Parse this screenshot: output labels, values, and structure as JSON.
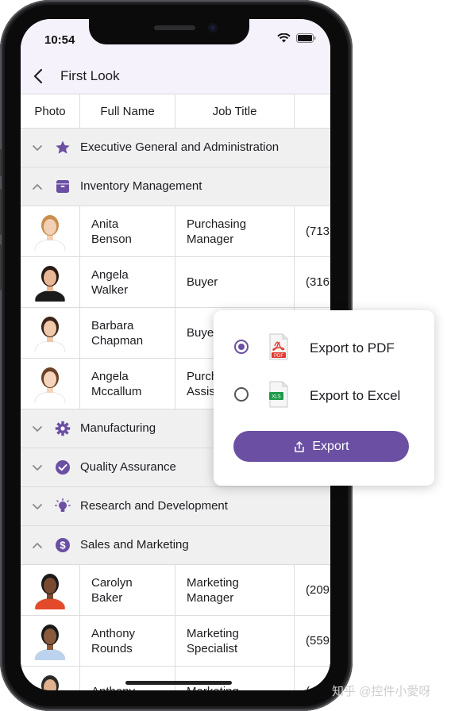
{
  "status": {
    "time": "10:54"
  },
  "appbar": {
    "title": "First Look"
  },
  "grid": {
    "columns": [
      "Photo",
      "Full Name",
      "Job Title"
    ],
    "groups": [
      {
        "label": "Executive General and Administration",
        "icon": "star-icon",
        "expanded": false
      },
      {
        "label": "Inventory Management",
        "icon": "box-icon",
        "expanded": true,
        "rows": [
          {
            "name": "Anita\nBenson",
            "job": "Purchasing\nManager",
            "phone": "(713"
          },
          {
            "name": "Angela\nWalker",
            "job": "Buyer",
            "phone": "(316"
          },
          {
            "name": "Barbara\nChapman",
            "job": "Buyer",
            "phone": ""
          },
          {
            "name": "Angela\nMccallum",
            "job": "Purchasing\nAssistant",
            "phone": ""
          }
        ]
      },
      {
        "label": "Manufacturing",
        "icon": "gear-icon",
        "expanded": false
      },
      {
        "label": "Quality Assurance",
        "icon": "check-circle-icon",
        "expanded": false
      },
      {
        "label": "Research and Development",
        "icon": "lightbulb-icon",
        "expanded": false
      },
      {
        "label": "Sales and Marketing",
        "icon": "dollar-circle-icon",
        "expanded": true,
        "rows": [
          {
            "name": "Carolyn\nBaker",
            "job": "Marketing\nManager",
            "phone": "(209"
          },
          {
            "name": "Anthony\nRounds",
            "job": "Marketing\nSpecialist",
            "phone": "(559"
          },
          {
            "name": "Anthony",
            "job": "Marketing",
            "phone": "("
          }
        ]
      }
    ]
  },
  "popup": {
    "options": [
      {
        "label": "Export to PDF",
        "selected": true,
        "file_icon": "pdf-file-icon",
        "badge": "PDF"
      },
      {
        "label": "Export to Excel",
        "selected": false,
        "file_icon": "xls-file-icon",
        "badge": "XLS"
      }
    ],
    "button_label": "Export"
  },
  "colors": {
    "accent": "#6a4fa3",
    "group_bg": "#f0f0f0",
    "appbar_bg": "#f5f2fb"
  },
  "watermark": "知乎 @控件小愛呀"
}
